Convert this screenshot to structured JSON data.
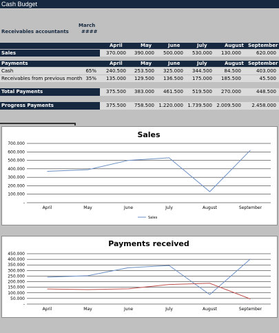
{
  "window": {
    "title": "Cash Budget"
  },
  "params": {
    "month_label": "March",
    "receivables_label": "Receivables accountants",
    "receivables_value": "####"
  },
  "months": [
    "April",
    "May",
    "June",
    "July",
    "August",
    "September"
  ],
  "sales_row": {
    "label": "Sales",
    "values": [
      "370.000",
      "390.000",
      "500.000",
      "530.000",
      "130.000",
      "620.000"
    ]
  },
  "payments_header": {
    "label": "Payments",
    "months": [
      "April",
      "May",
      "June",
      "July",
      "August",
      "September"
    ]
  },
  "cash_row": {
    "label": "Cash",
    "pct": "65%",
    "values": [
      "240.500",
      "253.500",
      "325.000",
      "344.500",
      "84.500",
      "403.000"
    ]
  },
  "recv_row": {
    "label": "Receivables from previous month",
    "pct": "35%",
    "values": [
      "135.000",
      "129.500",
      "136.500",
      "175.000",
      "185.500",
      "45.500"
    ]
  },
  "total_row": {
    "label": "Total Payments",
    "values": [
      "375.500",
      "383.000",
      "461.500",
      "519.500",
      "270.000",
      "448.500"
    ]
  },
  "progress_row": {
    "label": "Progress Payments",
    "values": [
      "375.500",
      "758.500",
      "1.220.000",
      "1.739.500",
      "2.009.500",
      "2.458.000"
    ]
  },
  "chart_data": [
    {
      "type": "line",
      "title": "Sales",
      "categories": [
        "April",
        "May",
        "June",
        "July",
        "August",
        "September"
      ],
      "y_tick_labels": [
        "-",
        "100.000",
        "200.000",
        "300.000",
        "400.000",
        "500.000",
        "600.000",
        "700.000"
      ],
      "ylim": [
        0,
        700000
      ],
      "grid": true,
      "legend_position": "bottom",
      "series": [
        {
          "name": "Sales",
          "color": "#6b8fc4",
          "values": [
            370000,
            390000,
            500000,
            530000,
            130000,
            620000
          ]
        }
      ]
    },
    {
      "type": "line",
      "title": "Payments received",
      "categories": [
        "April",
        "May",
        "June",
        "July",
        "August",
        "September"
      ],
      "y_tick_labels": [
        "-",
        "50.000",
        "100.000",
        "150.000",
        "200.000",
        "250.000",
        "300.000",
        "350.000",
        "400.000",
        "450.000"
      ],
      "ylim": [
        0,
        450000
      ],
      "grid": true,
      "series": [
        {
          "color": "#6b8fc4",
          "values": [
            240500,
            253500,
            325000,
            344500,
            84500,
            403000
          ]
        },
        {
          "color": "#c0504d",
          "values": [
            135000,
            129500,
            136500,
            175000,
            185500,
            45500
          ]
        }
      ]
    }
  ]
}
